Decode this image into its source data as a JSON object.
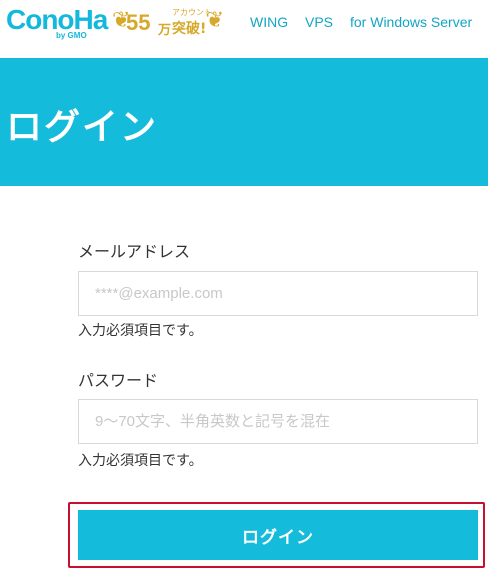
{
  "header": {
    "logo_text": "ConoHa",
    "logo_sub": "by GMO",
    "badge": {
      "number": "55",
      "unit": "万",
      "small_text": "アカウント",
      "main_text": "突破!"
    },
    "nav": [
      {
        "label": "WING"
      },
      {
        "label": "VPS"
      },
      {
        "label": "for Windows Server"
      }
    ]
  },
  "banner": {
    "title": "ログイン"
  },
  "form": {
    "email": {
      "label": "メールアドレス",
      "placeholder": "****@example.com",
      "value": "",
      "hint": "入力必須項目です。"
    },
    "password": {
      "label": "パスワード",
      "placeholder": "9～70文字、半角英数と記号を混在",
      "value": "",
      "hint": "入力必須項目です。"
    },
    "submit_label": "ログイン"
  },
  "colors": {
    "brand": "#14bbdb",
    "badge_gold": "#d7a92a",
    "highlight_border": "#c8102e"
  }
}
